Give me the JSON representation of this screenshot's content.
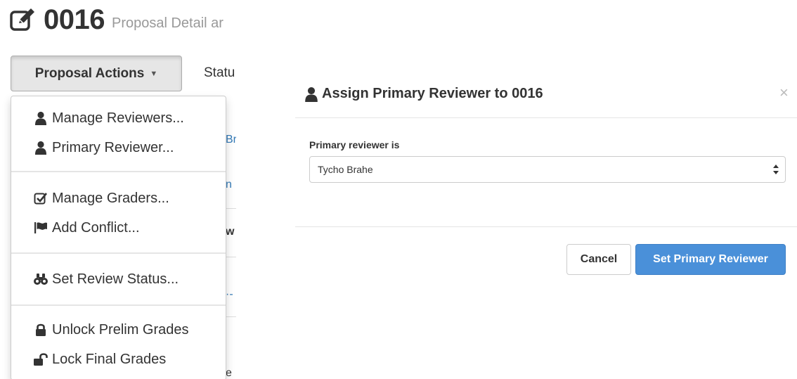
{
  "header": {
    "proposal_id": "0016",
    "subtitle": "Proposal Detail ar",
    "icon": "edit-icon"
  },
  "toolbar": {
    "actions_label": "Proposal Actions",
    "status_tab_label": "Statu"
  },
  "dropdown": {
    "items": [
      {
        "label": "Manage Reviewers...",
        "icon": "user-icon"
      },
      {
        "label": "Primary Reviewer...",
        "icon": "user-icon"
      },
      {
        "label": "Manage Graders...",
        "icon": "check-square-icon"
      },
      {
        "label": "Add Conflict...",
        "icon": "flag-icon"
      },
      {
        "label": "Set Review Status...",
        "icon": "binoculars-icon"
      },
      {
        "label": "Unlock Prelim Grades",
        "icon": "lock-icon"
      },
      {
        "label": "Lock Final Grades",
        "icon": "unlock-icon"
      }
    ]
  },
  "modal": {
    "title": "Assign Primary Reviewer to 0016",
    "close_symbol": "×",
    "field_label": "Primary reviewer is",
    "selected_reviewer": "Tycho Brahe",
    "cancel_label": "Cancel",
    "submit_label": "Set Primary Reviewer"
  },
  "colors": {
    "primary": "#4a90d9",
    "text": "#333333",
    "muted": "#999999",
    "link": "#337ab7"
  }
}
